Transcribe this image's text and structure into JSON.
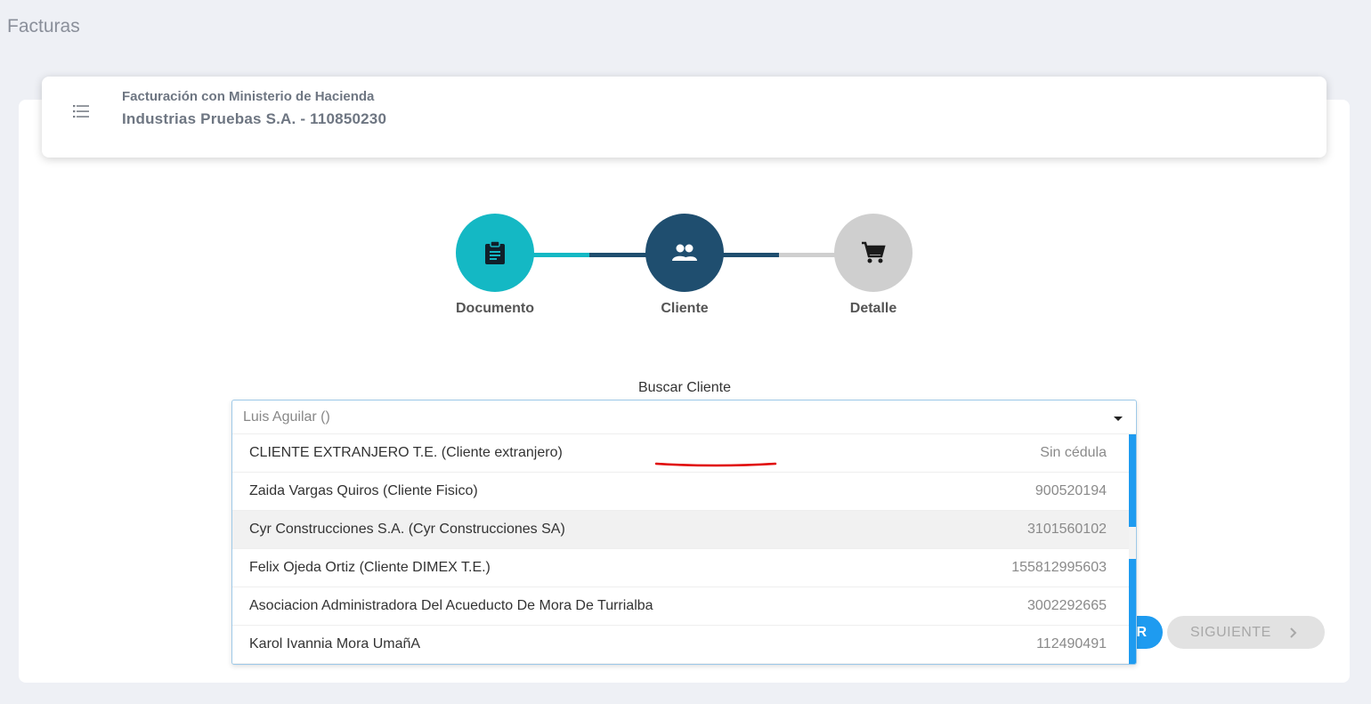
{
  "page": {
    "title": "Facturas"
  },
  "header": {
    "subtitle": "Facturación con Ministerio de Hacienda",
    "company": "Industrias Pruebas S.A. - 110850230"
  },
  "stepper": {
    "steps": [
      {
        "label": "Documento",
        "icon": "clipboard-icon",
        "state": "completed",
        "color": "#14b8c4"
      },
      {
        "label": "Cliente",
        "icon": "people-icon",
        "state": "active",
        "color": "#1f4e6f"
      },
      {
        "label": "Detalle",
        "icon": "cart-icon",
        "state": "pending",
        "color": "#cfcfcf"
      }
    ]
  },
  "client_search": {
    "label": "Buscar Cliente",
    "placeholder": "Luis Aguilar ()",
    "value": "",
    "options": [
      {
        "name": "CLIENTE EXTRANJERO T.E. (Cliente extranjero)",
        "id": "Sin cédula"
      },
      {
        "name": "Zaida Vargas Quiros (Cliente Fisico)",
        "id": "900520194"
      },
      {
        "name": "Cyr Construcciones S.A. (Cyr Construcciones SA)",
        "id": "3101560102"
      },
      {
        "name": "Felix Ojeda Ortiz (Cliente DIMEX T.E.)",
        "id": "155812995603"
      },
      {
        "name": "Asociacion Administradora Del Acueducto De Mora De Turrialba",
        "id": "3002292665"
      },
      {
        "name": "Karol Ivannia Mora UmañA",
        "id": "112490491"
      }
    ]
  },
  "buttons": {
    "prev_label": "R",
    "next_label": "SIGUIENTE"
  },
  "colors": {
    "accent": "#1e9bf0",
    "teal": "#14b8c4",
    "navy": "#1f4e6f",
    "disabled": "#cfcfcf",
    "annotation": "#e00000"
  }
}
